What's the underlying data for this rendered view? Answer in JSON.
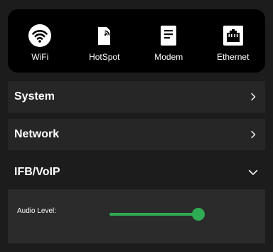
{
  "connections": [
    {
      "label": "WiFi",
      "icon": "wifi-icon"
    },
    {
      "label": "HotSpot",
      "icon": "hotspot-icon"
    },
    {
      "label": "Modem",
      "icon": "modem-icon"
    },
    {
      "label": "Ethernet",
      "icon": "ethernet-icon"
    }
  ],
  "sections": {
    "system": {
      "title": "System",
      "state": "collapsed",
      "icon": "chevron-right-icon"
    },
    "network": {
      "title": "Network",
      "state": "collapsed",
      "icon": "chevron-right-icon"
    },
    "ifb_voip": {
      "title": "IFB/VoIP",
      "state": "expanded",
      "icon": "chevron-down-icon",
      "audio_level": {
        "label": "Audio Level:",
        "value": 1.0
      }
    }
  },
  "colors": {
    "accent": "#2eab53",
    "background": "#1c1c1c",
    "connection_bar": "#000000",
    "row": "#262626",
    "panel": "#2b2b2b"
  }
}
